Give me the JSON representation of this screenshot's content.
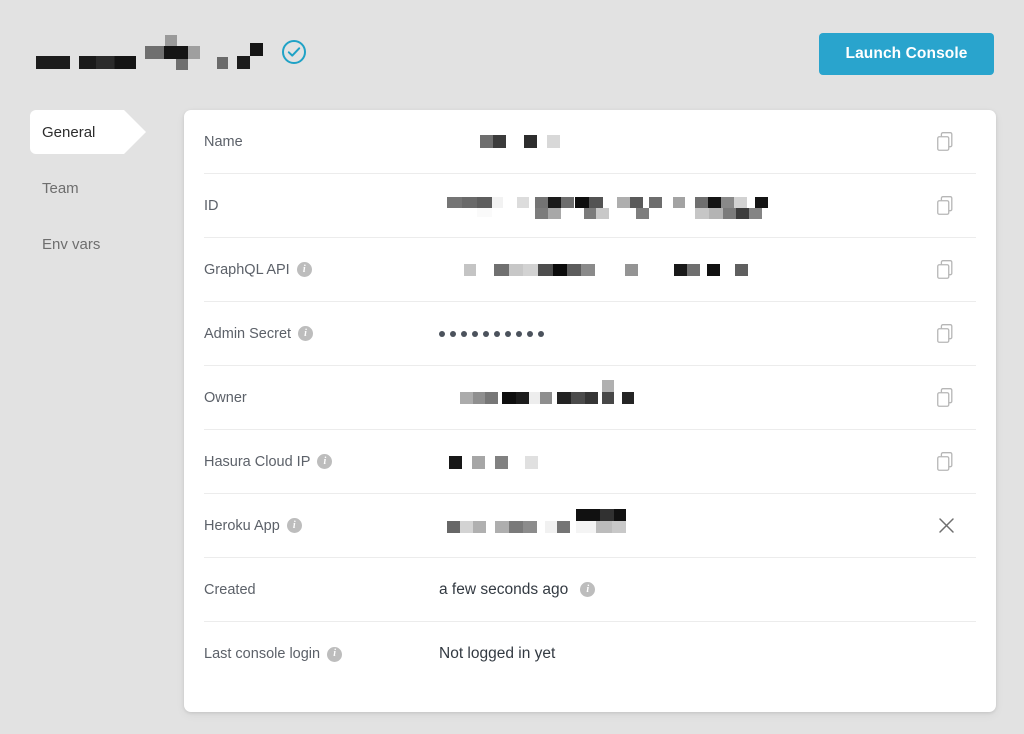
{
  "header": {
    "project_name_redacted": true,
    "status_icon": "check-circle-icon",
    "status_color": "#1fa2c6",
    "launch_button_label": "Launch Console",
    "launch_button_color": "#29a4cd"
  },
  "sidebar": {
    "items": [
      {
        "label": "General",
        "active": true
      },
      {
        "label": "Team",
        "active": false
      },
      {
        "label": "Env vars",
        "active": false
      }
    ]
  },
  "main": {
    "rows": [
      {
        "label": "Name",
        "has_info": false,
        "value_type": "redacted",
        "value": "",
        "action": "copy-icon"
      },
      {
        "label": "ID",
        "has_info": false,
        "value_type": "redacted",
        "value": "",
        "action": "copy-icon"
      },
      {
        "label": "GraphQL API",
        "has_info": true,
        "value_type": "redacted",
        "value": "",
        "action": "copy-icon"
      },
      {
        "label": "Admin Secret",
        "has_info": true,
        "value_type": "masked",
        "value": "••••••••••",
        "mask_dot_count": 10,
        "action": "copy-icon"
      },
      {
        "label": "Owner",
        "has_info": false,
        "value_type": "redacted",
        "value": "",
        "action": "copy-icon"
      },
      {
        "label": "Hasura Cloud IP",
        "has_info": true,
        "value_type": "redacted",
        "value": "",
        "action": "copy-icon"
      },
      {
        "label": "Heroku App",
        "has_info": true,
        "value_type": "redacted",
        "value": "",
        "action": "close-icon"
      },
      {
        "label": "Created",
        "has_info": false,
        "value_type": "text",
        "value": "a few seconds ago",
        "value_trailing_info": true,
        "action": "none"
      },
      {
        "label": "Last console login",
        "has_info": true,
        "value_type": "text",
        "value": "Not logged in yet",
        "action": "none"
      }
    ]
  },
  "colors": {
    "page_background": "#e2e2e2",
    "card_background": "#ffffff",
    "accent": "#29a4cd",
    "label_text": "#5c6169",
    "value_text": "#333a42",
    "divider": "#ececec"
  }
}
